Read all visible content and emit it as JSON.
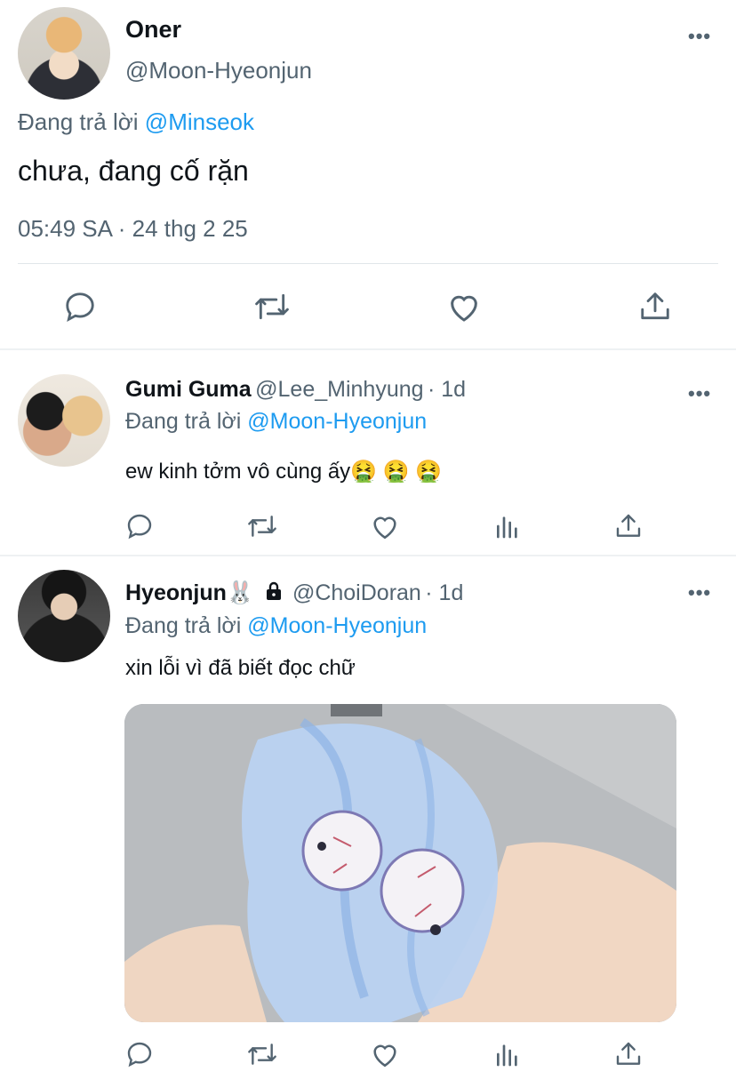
{
  "main_tweet": {
    "display_name": "Oner",
    "handle": "@Moon-Hyeonjun",
    "reply_prefix": "Đang trả lời",
    "reply_to": "@Minseok",
    "text": "chưa, đang cố rặn",
    "timestamp": "05:49 SA · 24 thg 2 25",
    "actions": [
      "reply-icon",
      "retweet-icon",
      "like-icon",
      "share-icon"
    ]
  },
  "replies": [
    {
      "display_name": "Gumi Guma",
      "handle": "@Lee_Minhyung",
      "age": "· 1d",
      "reply_prefix": "Đang trả lời",
      "reply_to": "@Moon-Hyeonjun",
      "text": "ew kinh tởm vô cùng ấy🤮 🤮 🤮",
      "actions": [
        "reply-icon",
        "retweet-icon",
        "like-icon",
        "views-icon",
        "share-icon"
      ]
    },
    {
      "display_name": "Hyeonjun🐰",
      "protected_icon": "lock-icon",
      "handle": "@ChoiDoran",
      "age": "· 1d",
      "reply_prefix": "Đang trả lời",
      "reply_to": "@Moon-Hyeonjun",
      "text": "xin lỗi vì đã biết đọc chữ",
      "media": "anime-hands-eyeballs-image",
      "actions": [
        "reply-icon",
        "retweet-icon",
        "like-icon",
        "views-icon",
        "share-icon"
      ]
    }
  ],
  "more_icon": "more-icon",
  "colors": {
    "link": "#1d9bf0",
    "muted": "#536471",
    "text": "#0f1419"
  }
}
